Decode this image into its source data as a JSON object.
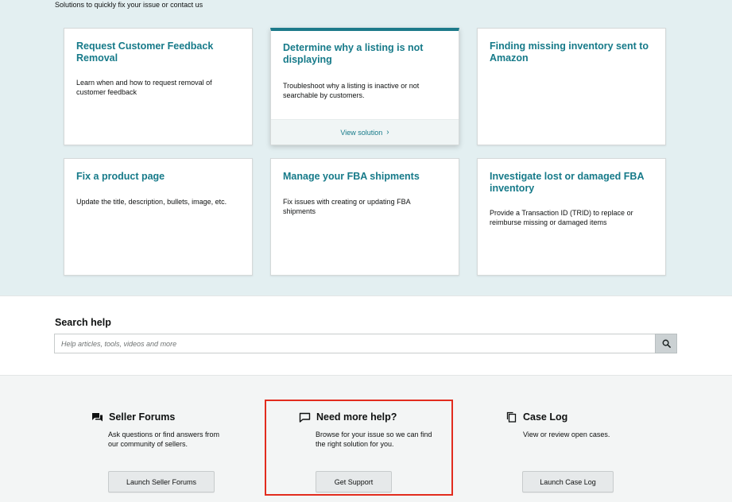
{
  "subtitle": "Solutions to quickly fix your issue or contact us",
  "cards": [
    {
      "title": "Request Customer Feedback Removal",
      "description": "Learn when and how to request removal of customer feedback"
    },
    {
      "title": "Determine why a listing is not displaying",
      "description": "Troubleshoot why a listing is inactive or not searchable by customers.",
      "footer": "View solution"
    },
    {
      "title": "Finding missing inventory sent to Amazon",
      "description": ""
    },
    {
      "title": "Fix a product page",
      "description": "Update the title, description, bullets, image, etc."
    },
    {
      "title": "Manage your FBA shipments",
      "description": "Fix issues with creating or updating FBA shipments"
    },
    {
      "title": "Investigate lost or damaged FBA inventory",
      "description": "Provide a Transaction ID (TRID) to replace or reimburse missing or damaged items"
    }
  ],
  "search": {
    "title": "Search help",
    "placeholder": "Help articles, tools, videos and more",
    "icon": "search-icon"
  },
  "help": {
    "forums": {
      "title": "Seller Forums",
      "description": "Ask questions or find answers from our community of sellers.",
      "button": "Launch Seller Forums",
      "icon": "forum-icon"
    },
    "support": {
      "title": "Need more help?",
      "description": "Browse for your issue so we can find the right solution for you.",
      "button": "Get Support",
      "icon": "chat-bubble-icon"
    },
    "caselog": {
      "title": "Case Log",
      "description": "View or review open cases.",
      "button": "Launch Case Log",
      "icon": "copy-icon"
    }
  },
  "colors": {
    "accent": "#167a89",
    "highlight": "#e22c1e",
    "top_bg": "#e3eff1"
  }
}
